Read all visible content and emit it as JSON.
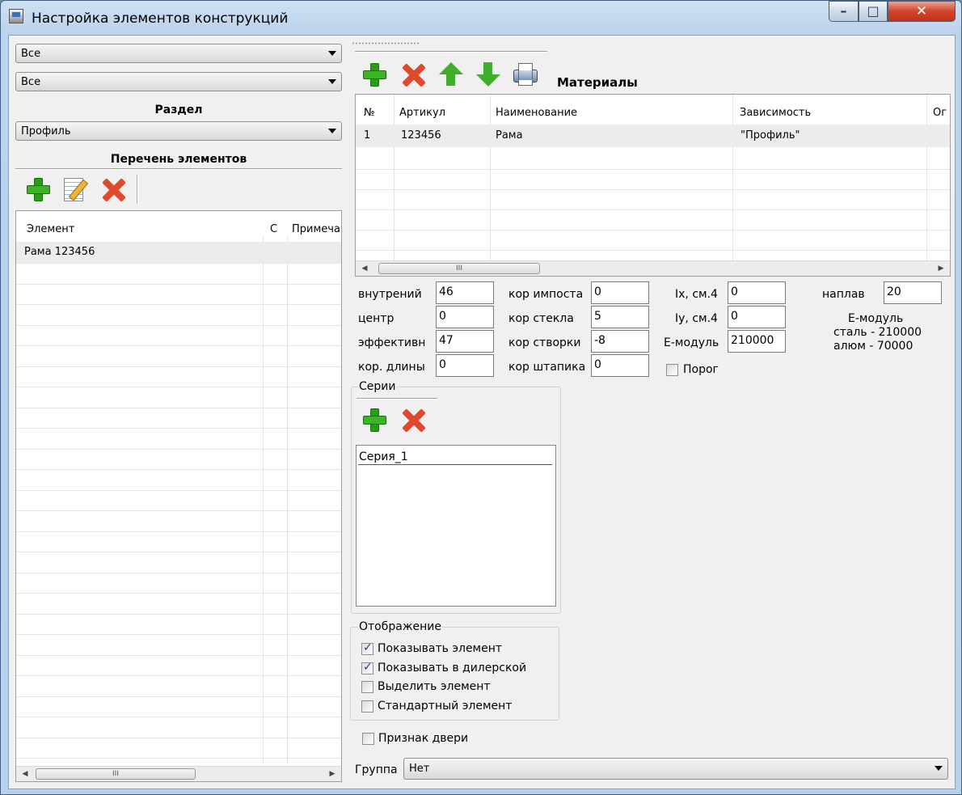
{
  "window": {
    "title": "Настройка элементов конструкций"
  },
  "left": {
    "filter1": "Все",
    "filter2": "Все",
    "section_label": "Раздел",
    "section_value": "Профиль",
    "list_label": "Перечень элементов",
    "grid": {
      "columns": [
        "Элемент",
        "С",
        "Примеча"
      ],
      "rows": [
        {
          "element": "Рама 123456"
        }
      ]
    },
    "scroll_thumb": "III"
  },
  "materials": {
    "title": "Материалы",
    "columns": [
      "№",
      "Артикул",
      "Наименование",
      "Зависимость",
      "Ог"
    ],
    "rows": [
      {
        "no": "1",
        "article": "123456",
        "name": "Рама",
        "dependency": "\"Профиль\""
      }
    ],
    "scroll_thumb": "III"
  },
  "fields": {
    "inner_label": "внутрений",
    "inner": "46",
    "center_label": "центр",
    "center": "0",
    "effective_label": "эффективн",
    "effective": "47",
    "len_corr_label": "кор. длины",
    "len_corr": "0",
    "impost_label": "кор импоста",
    "impost": "0",
    "glass_label": "кор стекла",
    "glass": "5",
    "sash_label": "кор створки",
    "sash": "-8",
    "bead_label": "кор штапика",
    "bead": "0",
    "ix_label": "Ix, см.4",
    "ix": "0",
    "iy_label": "Iy, см.4",
    "iy": "0",
    "emod_label": "Е-модуль",
    "emod": "210000",
    "threshold_label": "Порог",
    "naplav_label": "наплав",
    "naplav": "20",
    "emod_note1": "Е-модуль",
    "emod_note2": "сталь - 210000",
    "emod_note3": "алюм - 70000"
  },
  "series": {
    "label": "Серии",
    "items": [
      "Серия_1"
    ]
  },
  "display": {
    "label": "Отображение",
    "show_element": "Показывать элемент",
    "show_dealer": "Показывать в дилерской",
    "highlight": "Выделить элемент",
    "standard": "Стандартный элемент"
  },
  "door_label": "Признак двери",
  "group_label": "Группа",
  "group_value": "Нет",
  "state": {
    "show_element": true,
    "show_dealer": true,
    "highlight": false,
    "standard": false,
    "threshold": false,
    "door": false
  }
}
